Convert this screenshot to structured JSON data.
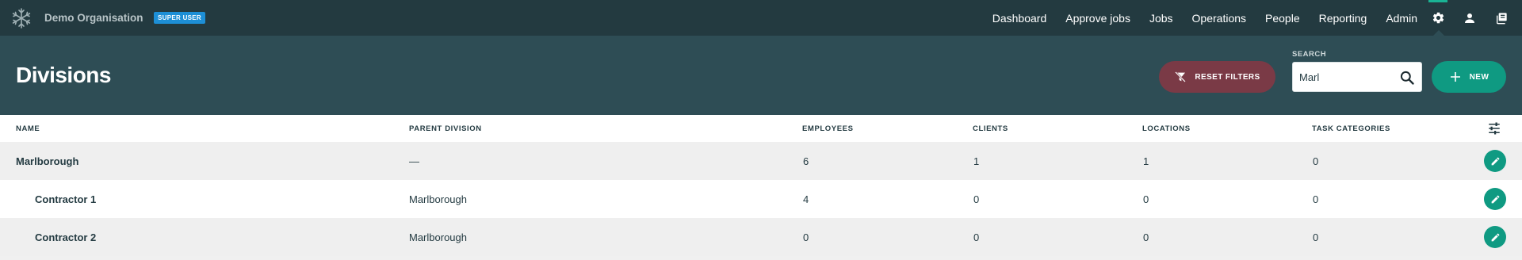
{
  "org": {
    "name": "Demo Organisation",
    "badge": "SUPER USER"
  },
  "nav": {
    "items": [
      "Dashboard",
      "Approve jobs",
      "Jobs",
      "Operations",
      "People",
      "Reporting",
      "Admin"
    ],
    "icons": [
      "gear-icon",
      "user-icon",
      "copy-icon"
    ]
  },
  "page": {
    "title": "Divisions"
  },
  "toolbar": {
    "reset_label": "RESET FILTERS",
    "search_label": "SEARCH",
    "search_value": "Marl",
    "new_label": "NEW"
  },
  "table": {
    "columns": [
      "NAME",
      "PARENT DIVISION",
      "EMPLOYEES",
      "CLIENTS",
      "LOCATIONS",
      "TASK CATEGORIES"
    ],
    "rows": [
      {
        "name": "Marlborough",
        "parent": "—",
        "employees": "6",
        "clients": "1",
        "locations": "1",
        "task_categories": "0"
      },
      {
        "name": "Contractor 1",
        "parent": "Marlborough",
        "employees": "4",
        "clients": "0",
        "locations": "0",
        "task_categories": "0"
      },
      {
        "name": "Contractor 2",
        "parent": "Marlborough",
        "employees": "0",
        "clients": "0",
        "locations": "0",
        "task_categories": "0"
      }
    ]
  },
  "colors": {
    "navbar": "#233a40",
    "header": "#2e4d55",
    "accent": "#0f9a82",
    "reset": "#7a3a46",
    "badge": "#1d8fd6"
  }
}
